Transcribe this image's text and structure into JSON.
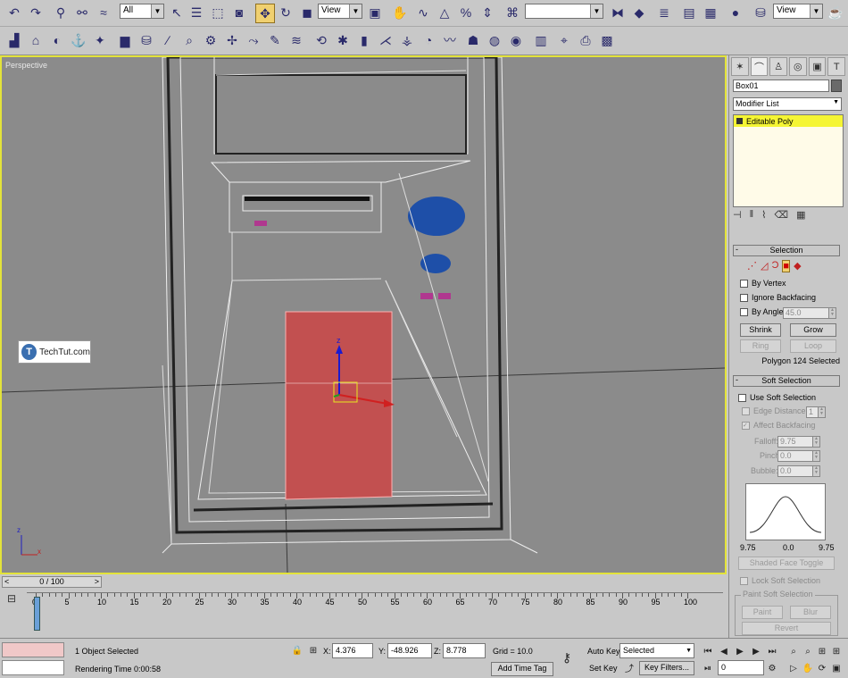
{
  "toolbar": {
    "selection_filter": "All",
    "ref_coord": "View",
    "named_sel": "",
    "ref_coord2": "View"
  },
  "viewport": {
    "label": "Perspective",
    "watermark": "TechTut.com",
    "watermark_logo": "T"
  },
  "command_panel": {
    "object_name": "Box01",
    "modifier_list": "Modifier List",
    "stack_item": "Editable Poly",
    "selection": {
      "title": "Selection",
      "by_vertex": "By Vertex",
      "ignore_backfacing": "Ignore Backfacing",
      "by_angle": "By Angle:",
      "by_angle_value": "45.0",
      "shrink": "Shrink",
      "grow": "Grow",
      "ring": "Ring",
      "loop": "Loop",
      "status": "Polygon 124 Selected"
    },
    "soft_selection": {
      "title": "Soft Selection",
      "use": "Use Soft Selection",
      "edge_distance": "Edge Distance:",
      "edge_distance_value": "1",
      "affect_backfacing": "Affect Backfacing",
      "falloff": "Falloff:",
      "falloff_value": "9.75",
      "pinch": "Pinch:",
      "pinch_value": "0.0",
      "bubble": "Bubble:",
      "bubble_value": "0.0",
      "curve_left": "9.75",
      "curve_mid": "0.0",
      "curve_right": "9.75",
      "shaded_face_toggle": "Shaded Face Toggle",
      "lock": "Lock Soft Selection",
      "paint_group": "Paint Soft Selection",
      "paint": "Paint",
      "blur": "Blur",
      "revert": "Revert"
    }
  },
  "timeline": {
    "slider": "0 / 100",
    "ticks": [
      "0",
      "5",
      "10",
      "15",
      "20",
      "25",
      "30",
      "35",
      "40",
      "45",
      "50",
      "55",
      "60",
      "65",
      "70",
      "75",
      "80",
      "85",
      "90",
      "95",
      "100"
    ]
  },
  "status": {
    "selected": "1 Object Selected",
    "rendering": "Rendering Time  0:00:58",
    "x_label": "X:",
    "x": "4.376",
    "y_label": "Y:",
    "y": "-48.926",
    "z_label": "Z:",
    "z": "8.778",
    "grid": "Grid = 10.0",
    "add_time_tag": "Add Time Tag",
    "auto_key": "Auto Key",
    "set_key": "Set Key",
    "key_mode": "Selected",
    "key_filters": "Key Filters...",
    "frame": "0"
  }
}
